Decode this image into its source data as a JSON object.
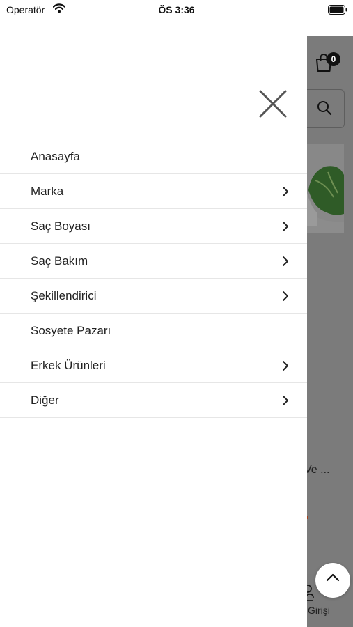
{
  "status_bar": {
    "carrier": "Operatör",
    "time": "ÖS 3:36"
  },
  "drawer": {
    "close_icon": "close-x-icon",
    "menu_items": [
      {
        "label": "Anasayfa",
        "has_submenu": false
      },
      {
        "label": "Marka",
        "has_submenu": true
      },
      {
        "label": "Saç Boyası",
        "has_submenu": true
      },
      {
        "label": "Saç Bakım",
        "has_submenu": true
      },
      {
        "label": "Şekillendirici",
        "has_submenu": true
      },
      {
        "label": "Sosyete Pazarı",
        "has_submenu": false
      },
      {
        "label": "Erkek Ürünleri",
        "has_submenu": true
      },
      {
        "label": "Diğer",
        "has_submenu": true
      }
    ]
  },
  "background_app": {
    "cart_count": "0",
    "product_text_fragment": "Ve ...",
    "login_label_fragment": "Girişi"
  },
  "colors": {
    "overlay": "#7b7b7b",
    "divider": "#e6e6e6",
    "accent_price": "#a4421d"
  }
}
